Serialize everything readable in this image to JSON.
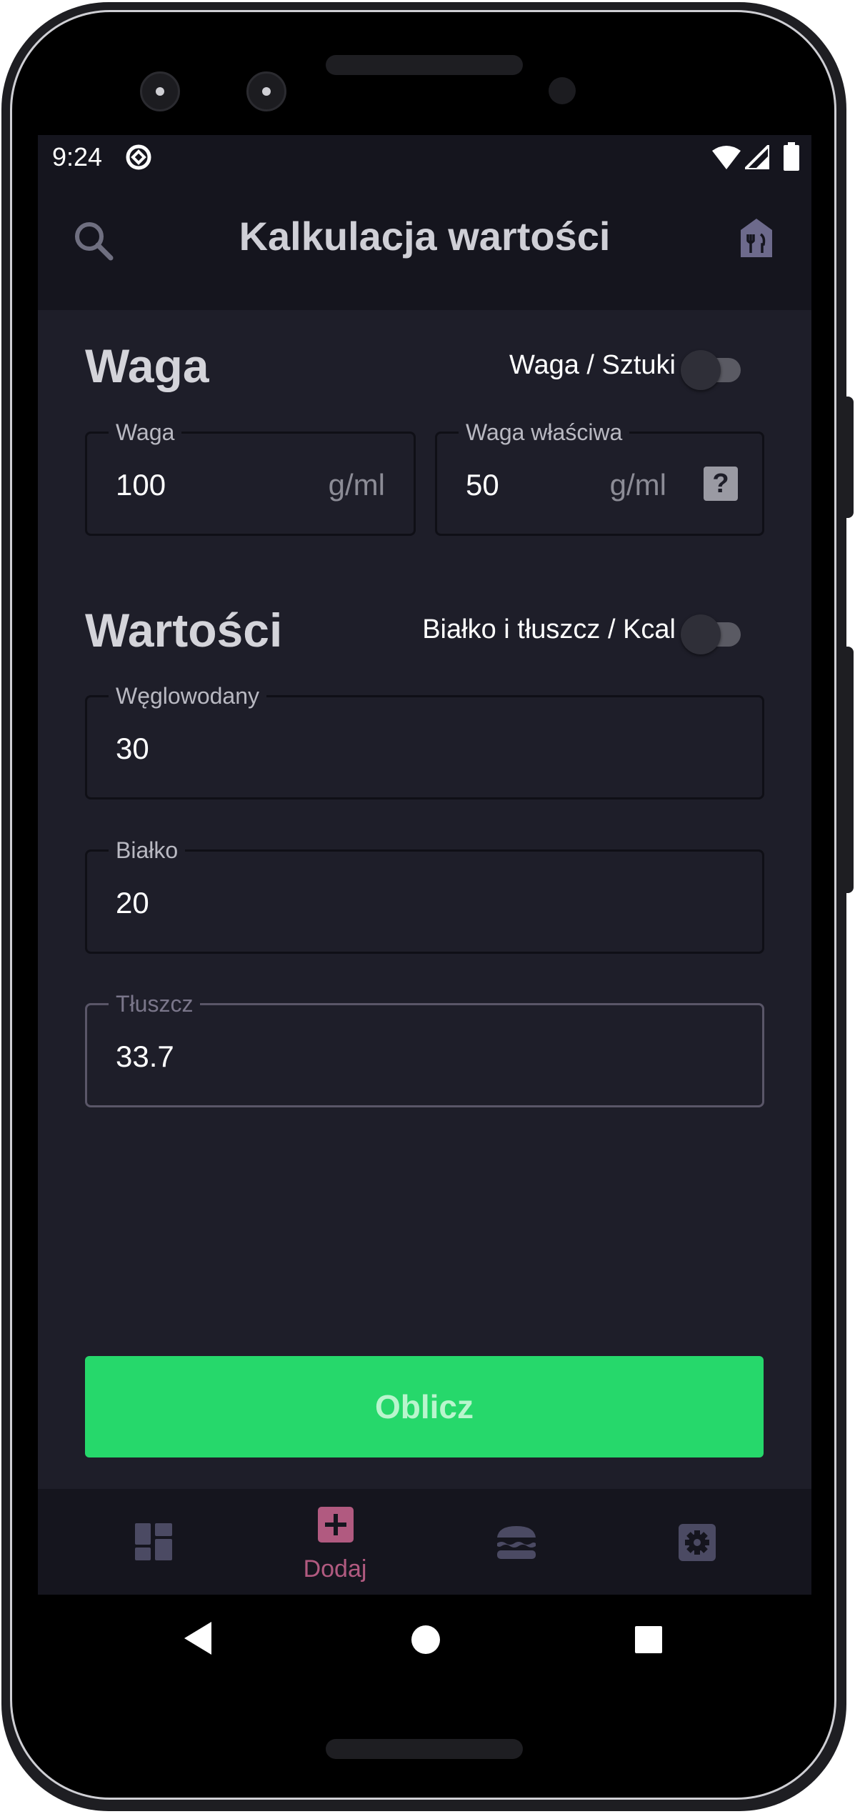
{
  "status_bar": {
    "time": "9:24"
  },
  "app_bar": {
    "title": "Kalkulacja wartości"
  },
  "weight_section": {
    "title": "Waga",
    "toggle_label": "Waga / Sztuki",
    "fields": [
      {
        "label": "Waga",
        "value": "100",
        "suffix": "g/ml"
      },
      {
        "label": "Waga właściwa",
        "value": "50",
        "suffix": "g/ml",
        "help": "?"
      }
    ]
  },
  "values_section": {
    "title": "Wartości",
    "toggle_label": "Białko i tłuszcz / Kcal",
    "fields": [
      {
        "label": "Węglowodany",
        "value": "30"
      },
      {
        "label": "Białko",
        "value": "20"
      },
      {
        "label": "Tłuszcz",
        "value": "33.7"
      }
    ]
  },
  "action_button": {
    "label": "Oblicz",
    "color": "#26d86b"
  },
  "bottom_nav": {
    "items": [
      {
        "icon": "dashboard-icon",
        "label": ""
      },
      {
        "icon": "add-box-icon",
        "label": "Dodaj",
        "active": true
      },
      {
        "icon": "burger-icon",
        "label": ""
      },
      {
        "icon": "settings-icon",
        "label": ""
      }
    ]
  },
  "colors": {
    "background": "#1e1e29",
    "bar": "#15151e",
    "accent": "#b15a80",
    "primary": "#26d86b"
  }
}
